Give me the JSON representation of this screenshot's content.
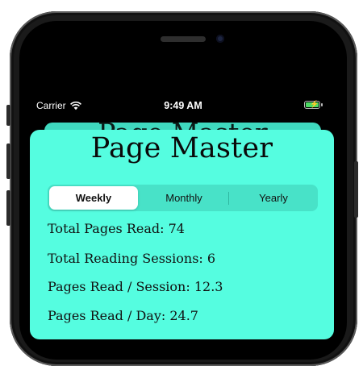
{
  "status_bar": {
    "carrier": "Carrier",
    "time": "9:49 AM"
  },
  "background_title": "Page Master",
  "app": {
    "title": "Page Master"
  },
  "segments": [
    "Weekly",
    "Monthly",
    "Yearly"
  ],
  "selected_segment": "Weekly",
  "stats": [
    "Total Pages Read: 74",
    "Total Reading Sessions: 6",
    "Pages Read / Session: 12.3",
    "Pages Read / Day: 24.7"
  ],
  "colors": {
    "card": "#55fde0",
    "segment_track": "#48e2c8",
    "battery": "#4cd964"
  },
  "icons": {
    "wifi": "wifi-icon",
    "battery": "battery-charging-icon"
  }
}
